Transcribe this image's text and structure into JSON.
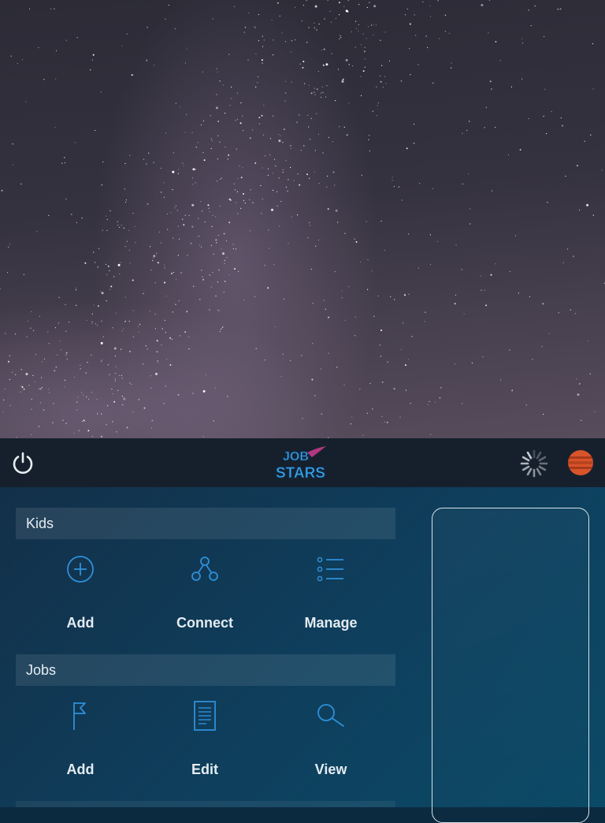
{
  "topbar": {
    "power_icon": "power-icon",
    "logo_line1": "JOB",
    "logo_line2": "STARS",
    "spinner_icon": "loading-spinner-icon",
    "planet_icon": "planet-icon"
  },
  "sections": [
    {
      "title": "Kids",
      "actions": [
        {
          "label": "Add",
          "icon": "plus-circle-icon"
        },
        {
          "label": "Connect",
          "icon": "connect-nodes-icon"
        },
        {
          "label": "Manage",
          "icon": "list-icon"
        }
      ]
    },
    {
      "title": "Jobs",
      "actions": [
        {
          "label": "Add",
          "icon": "flag-icon"
        },
        {
          "label": "Edit",
          "icon": "document-icon"
        },
        {
          "label": "View",
          "icon": "search-icon"
        }
      ]
    }
  ],
  "colors": {
    "accent": "#2f8fd8",
    "topbar_bg": "#16202d",
    "panel_bg": "#0e3f5d",
    "text": "#e4ebf1",
    "planet": "#d9532b"
  }
}
